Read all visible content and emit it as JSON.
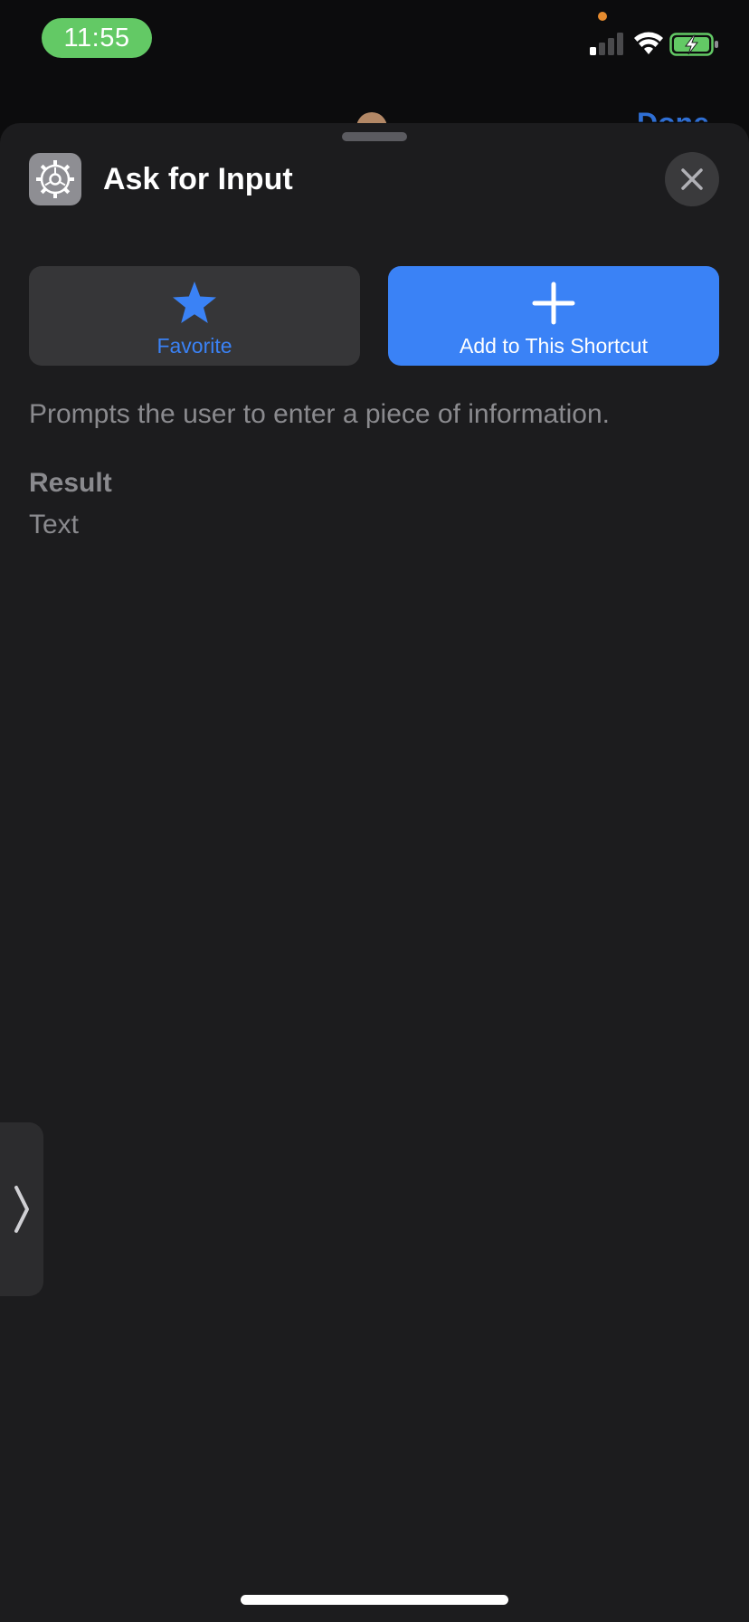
{
  "status_bar": {
    "time": "11:55",
    "time_pill_color": "#63c965",
    "privacy_dot_color": "#e58b2f",
    "icons": [
      "signal-icon",
      "wifi-icon",
      "battery-charging-icon"
    ]
  },
  "background": {
    "done_label": "Done"
  },
  "sheet": {
    "icon": "gear-icon",
    "title": "Ask for Input",
    "close_icon": "close-icon",
    "favorite": {
      "icon": "star-icon",
      "label": "Favorite"
    },
    "add": {
      "icon": "plus-icon",
      "label": "Add to This Shortcut"
    },
    "description": "Prompts the user to enter a piece of information.",
    "result_heading": "Result",
    "result_value": "Text"
  },
  "side_tab": {
    "icon": "chevron-right-icon"
  },
  "colors": {
    "accent": "#3a82f6",
    "sheet_background": "#1c1c1e",
    "secondary_text": "#8a8a8e"
  }
}
